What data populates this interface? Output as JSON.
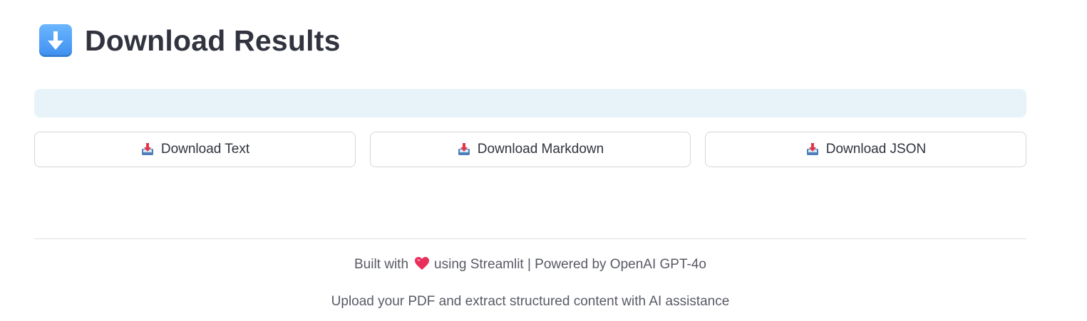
{
  "header": {
    "icon": "down-arrow-icon",
    "title": "Download Results",
    "icon_color": "#4a9af2"
  },
  "info_bar": {
    "text": "",
    "color": "#e8f3f9"
  },
  "downloads": {
    "icon": "inbox-tray-icon",
    "buttons": [
      {
        "label": "Download Text"
      },
      {
        "label": "Download Markdown"
      },
      {
        "label": "Download JSON"
      }
    ]
  },
  "footer": {
    "built_with": "Built with",
    "heart_icon": "heart-icon",
    "powered_by": "using Streamlit | Powered by OpenAI GPT-4o",
    "tagline": "Upload your PDF and extract structured content with AI assistance",
    "heart_color": "#e8305a"
  }
}
